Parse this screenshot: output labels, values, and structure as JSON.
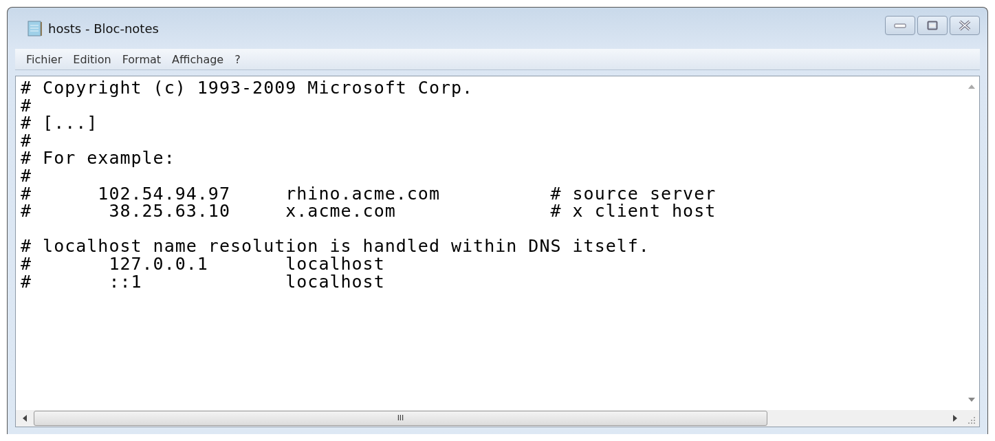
{
  "window": {
    "title": "hosts - Bloc-notes"
  },
  "menu": [
    "Fichier",
    "Edition",
    "Format",
    "Affichage",
    "?"
  ],
  "editor": {
    "paragraphs": [
      [
        "# Copyright (c) 1993-2009 Microsoft Corp.",
        "#",
        "# [...]",
        "#",
        "# For example:",
        "#",
        "#      102.54.94.97     rhino.acme.com          # source server",
        "#       38.25.63.10     x.acme.com              # x client host"
      ],
      [
        "# localhost name resolution is handled within DNS itself.",
        "#       127.0.0.1       localhost",
        "#       ::1             localhost"
      ]
    ]
  },
  "scrollbar": {
    "grip": "III"
  }
}
